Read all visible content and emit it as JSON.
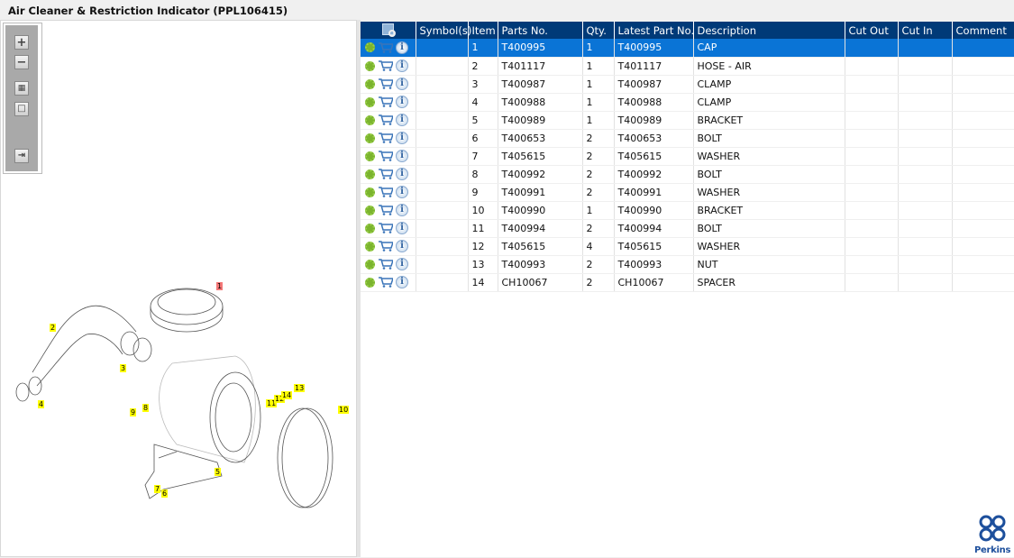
{
  "title": "Air Cleaner & Restriction Indicator (PPL106415)",
  "toolbar": {
    "zoom_in": "zoom-in",
    "zoom_out": "zoom-out",
    "fit": "fit-all",
    "actual": "actual-size",
    "export": "export-list"
  },
  "columns": [
    "",
    "Symbol(s)",
    "Item",
    "Parts No.",
    "Qty.",
    "Latest Part No.",
    "Description",
    "Cut Out",
    "Cut In",
    "Comment"
  ],
  "rows": [
    {
      "item": "1",
      "part": "T400995",
      "qty": "1",
      "latest": "T400995",
      "desc": "CAP"
    },
    {
      "item": "2",
      "part": "T401117",
      "qty": "1",
      "latest": "T401117",
      "desc": "HOSE - AIR"
    },
    {
      "item": "3",
      "part": "T400987",
      "qty": "1",
      "latest": "T400987",
      "desc": "CLAMP"
    },
    {
      "item": "4",
      "part": "T400988",
      "qty": "1",
      "latest": "T400988",
      "desc": "CLAMP"
    },
    {
      "item": "5",
      "part": "T400989",
      "qty": "1",
      "latest": "T400989",
      "desc": "BRACKET"
    },
    {
      "item": "6",
      "part": "T400653",
      "qty": "2",
      "latest": "T400653",
      "desc": "BOLT"
    },
    {
      "item": "7",
      "part": "T405615",
      "qty": "2",
      "latest": "T405615",
      "desc": "WASHER"
    },
    {
      "item": "8",
      "part": "T400992",
      "qty": "2",
      "latest": "T400992",
      "desc": "BOLT"
    },
    {
      "item": "9",
      "part": "T400991",
      "qty": "2",
      "latest": "T400991",
      "desc": "WASHER"
    },
    {
      "item": "10",
      "part": "T400990",
      "qty": "1",
      "latest": "T400990",
      "desc": "BRACKET"
    },
    {
      "item": "11",
      "part": "T400994",
      "qty": "2",
      "latest": "T400994",
      "desc": "BOLT"
    },
    {
      "item": "12",
      "part": "T405615",
      "qty": "4",
      "latest": "T405615",
      "desc": "WASHER"
    },
    {
      "item": "13",
      "part": "T400993",
      "qty": "2",
      "latest": "T400993",
      "desc": "NUT"
    },
    {
      "item": "14",
      "part": "CH10067",
      "qty": "2",
      "latest": "CH10067",
      "desc": "SPACER"
    }
  ],
  "selected_row": 0,
  "callouts": [
    "1",
    "2",
    "3",
    "4",
    "5",
    "6",
    "7",
    "8",
    "9",
    "10",
    "11",
    "12",
    "13",
    "14"
  ],
  "logo": "Perkins",
  "colors": {
    "header": "#003a78",
    "selected": "#0a74d6",
    "callout": "#ffff00",
    "callout_selected": "#f57878"
  }
}
